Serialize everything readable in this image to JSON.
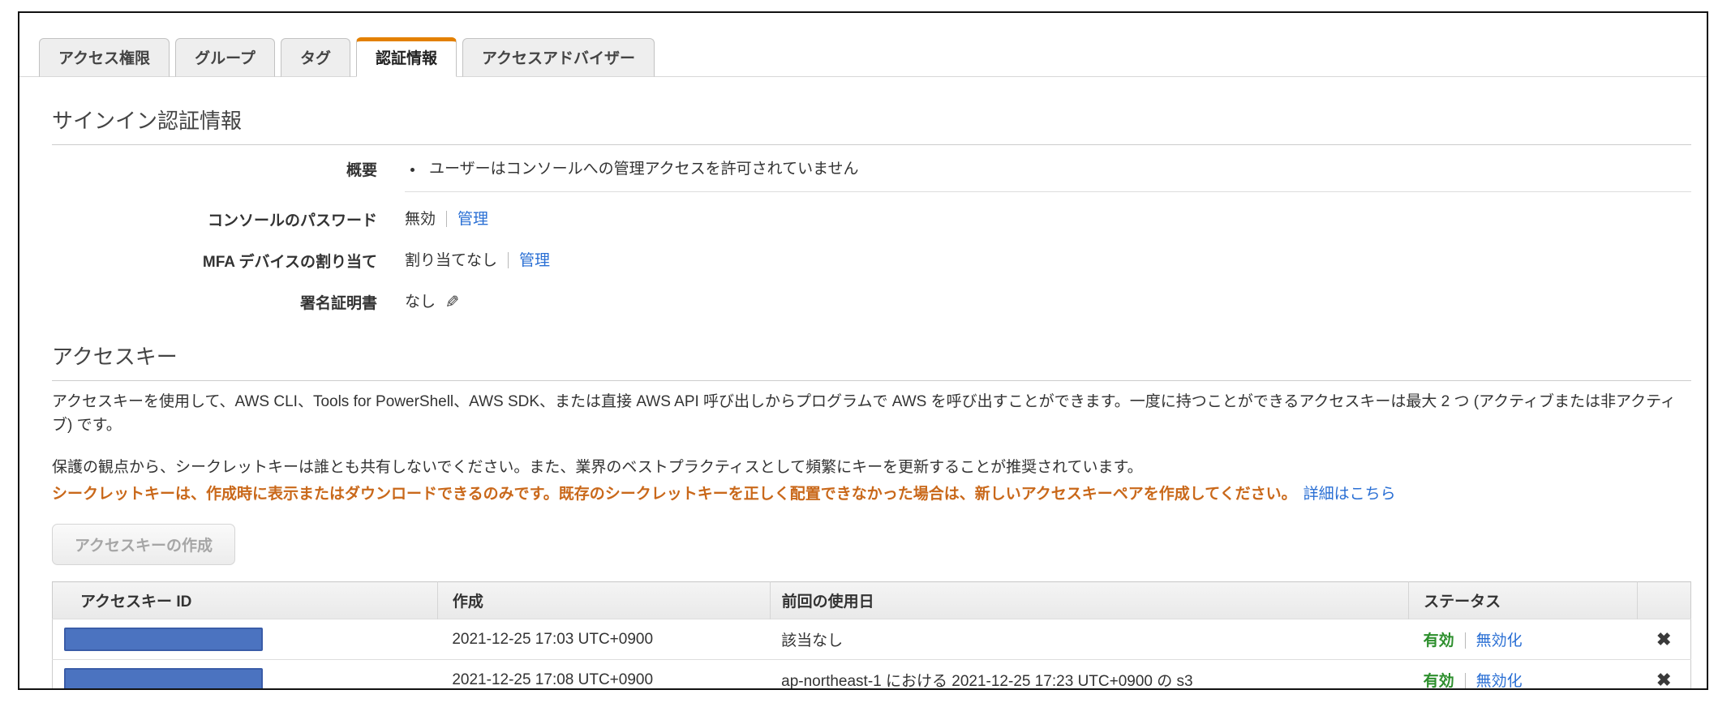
{
  "tabs": {
    "items": [
      {
        "label": "アクセス権限"
      },
      {
        "label": "グループ"
      },
      {
        "label": "タグ"
      },
      {
        "label": "認証情報"
      },
      {
        "label": "アクセスアドバイザー"
      }
    ],
    "active_index": 3
  },
  "signin": {
    "title": "サインイン認証情報",
    "summary_label": "概要",
    "summary_bullet": "ユーザーはコンソールへの管理アクセスを許可されていません",
    "console_password_label": "コンソールのパスワード",
    "console_password_value": "無効",
    "console_password_action": "管理",
    "mfa_label": "MFA デバイスの割り当て",
    "mfa_value": "割り当てなし",
    "mfa_action": "管理",
    "signing_cert_label": "署名証明書",
    "signing_cert_value": "なし"
  },
  "access_keys": {
    "title": "アクセスキー",
    "description": "アクセスキーを使用して、AWS CLI、Tools for PowerShell、AWS SDK、または直接 AWS API 呼び出しからプログラムで AWS を呼び出すことができます。一度に持つことができるアクセスキーは最大 2 つ (アクティブまたは非アクティブ) です。",
    "advice": "保護の観点から、シークレットキーは誰とも共有しないでください。また、業界のベストプラクティスとして頻繁にキーを更新することが推奨されています。",
    "warning": "シークレットキーは、作成時に表示またはダウンロードできるのみです。既存のシークレットキーを正しく配置できなかった場合は、新しいアクセスキーペアを作成してください。",
    "learn_more": "詳細はこちら",
    "create_button": "アクセスキーの作成",
    "table": {
      "headers": [
        "アクセスキー ID",
        "作成",
        "前回の使用日",
        "ステータス"
      ],
      "rows": [
        {
          "created": "2021-12-25 17:03 UTC+0900",
          "last_used": "該当なし",
          "status": "有効",
          "action": "無効化"
        },
        {
          "created": "2021-12-25 17:08 UTC+0900",
          "last_used": "ap-northeast-1 における 2021-12-25 17:23 UTC+0900 の s3",
          "status": "有効",
          "action": "無効化"
        }
      ]
    }
  },
  "icons": {
    "edit": "✎",
    "delete": "✖"
  },
  "colors": {
    "tab_accent": "#e38000",
    "link": "#2a6fd4",
    "warning": "#c9681a",
    "status_active": "#2d8f2d",
    "redaction_fill": "#4b73c0",
    "redaction_border": "#3a5ca8"
  }
}
